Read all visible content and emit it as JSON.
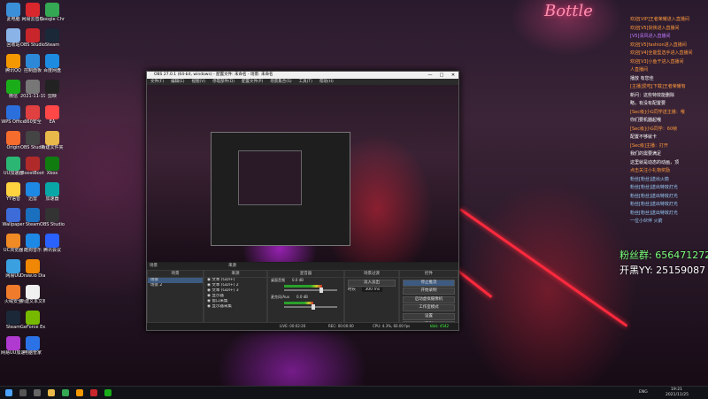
{
  "desktop_icons": [
    {
      "label": "此电脑",
      "color": "#3a8fd8",
      "col": 0,
      "row": 0
    },
    {
      "label": "网易云音乐",
      "color": "#d8282d",
      "col": 1,
      "row": 0
    },
    {
      "label": "Google Chrome",
      "color": "#34a853",
      "col": 2,
      "row": 0
    },
    {
      "label": "回收站",
      "color": "#8ab4e8",
      "col": 0,
      "row": 1
    },
    {
      "label": "OBS Studio",
      "color": "#c8262b",
      "col": 1,
      "row": 1
    },
    {
      "label": "Steam",
      "color": "#1b2838",
      "col": 2,
      "row": 1
    },
    {
      "label": "腾讯QQ",
      "color": "#f39800",
      "col": 0,
      "row": 2
    },
    {
      "label": "控制面板",
      "color": "#2d89d8",
      "col": 1,
      "row": 2
    },
    {
      "label": "百度网盘",
      "color": "#1c8be0",
      "col": 2,
      "row": 2
    },
    {
      "label": "微信",
      "color": "#1aad19",
      "col": 0,
      "row": 3
    },
    {
      "label": "2021-11-19",
      "color": "#777777",
      "col": 1,
      "row": 3
    },
    {
      "label": "剪映",
      "color": "#222222",
      "col": 2,
      "row": 3
    },
    {
      "label": "WPS Office",
      "color": "#2a6fdb",
      "col": 0,
      "row": 4
    },
    {
      "label": "360安全",
      "color": "#e04040",
      "col": 1,
      "row": 4
    },
    {
      "label": "EA",
      "color": "#ff4747",
      "col": 2,
      "row": 4
    },
    {
      "label": "Origin",
      "color": "#f56c2d",
      "col": 0,
      "row": 5
    },
    {
      "label": "OBS Studio",
      "color": "#444444",
      "col": 1,
      "row": 5
    },
    {
      "label": "新建文件夹",
      "color": "#e8b84a",
      "col": 2,
      "row": 5
    },
    {
      "label": "UU加速器",
      "color": "#2bb673",
      "col": 0,
      "row": 6
    },
    {
      "label": "BoostBoot",
      "color": "#b12a2a",
      "col": 1,
      "row": 6
    },
    {
      "label": "Xbox",
      "color": "#107c10",
      "col": 2,
      "row": 6
    },
    {
      "label": "YY语音",
      "color": "#ffd23f",
      "col": 0,
      "row": 7
    },
    {
      "label": "迅雷",
      "color": "#1e88e5",
      "col": 1,
      "row": 7
    },
    {
      "label": "加速器",
      "color": "#0aa7a7",
      "col": 2,
      "row": 7
    },
    {
      "label": "Wallpaper",
      "color": "#3d6bd8",
      "col": 0,
      "row": 8
    },
    {
      "label": "Steam",
      "color": "#1b6fbf",
      "col": 1,
      "row": 8
    },
    {
      "label": "OBS Studio",
      "color": "#333333",
      "col": 2,
      "row": 8
    },
    {
      "label": "UC浏览器",
      "color": "#f08a24",
      "col": 0,
      "row": 9
    },
    {
      "label": "酷狗音乐",
      "color": "#1e88e5",
      "col": 1,
      "row": 9
    },
    {
      "label": "腾讯会议",
      "color": "#2962ff",
      "col": 2,
      "row": 9
    },
    {
      "label": "网易UU",
      "color": "#3aa0e0",
      "col": 0,
      "row": 10
    },
    {
      "label": "Draw.io Diagrams",
      "color": "#f08705",
      "col": 1,
      "row": 10
    },
    {
      "label": "火绒安全",
      "color": "#f07b2b",
      "col": 0,
      "row": 11
    },
    {
      "label": "新建文本文档",
      "color": "#f0f0f0",
      "col": 1,
      "row": 11
    },
    {
      "label": "Steam",
      "color": "#1b2838",
      "col": 0,
      "row": 12
    },
    {
      "label": "GeForce Experience",
      "color": "#76b900",
      "col": 1,
      "row": 12
    },
    {
      "label": "网易UU加速器",
      "color": "#b03ad0",
      "col": 0,
      "row": 13
    },
    {
      "label": "电脑管家",
      "color": "#2b72e6",
      "col": 1,
      "row": 13
    }
  ],
  "chat": [
    {
      "text": "欢迎[VIP]王者荣耀进入直播间",
      "color": "#ff9a3d"
    },
    {
      "text": "欢迎[V5]剑侠进入直播间",
      "color": "#ff9a3d"
    },
    {
      "text": "[V5]清风进入直播间",
      "color": "#c07bff"
    },
    {
      "text": "欢迎[V5]fashion进入直播间",
      "color": "#ff9a3d"
    },
    {
      "text": "欢迎[V4]全能型选手进入直播间",
      "color": "#ff9a3d"
    },
    {
      "text": "欢迎[V3]小鱼干进入直播间",
      "color": "#ff9a3d"
    },
    {
      "text": "人直播间",
      "color": "#ff9a3d"
    },
    {
      "text": "播放 有您佳",
      "color": "#ffffff"
    },
    {
      "text": "[主播]爱吃[下载]王者荣耀有",
      "color": "#ff9a3d"
    },
    {
      "text": "新问：这些特效能删除",
      "color": "#ffffff"
    },
    {
      "text": "略，有没有配置要",
      "color": "#ffffff"
    },
    {
      "text": "[Sec级]小G同学送主播：哦",
      "color": "#ff9a3d"
    },
    {
      "text": "你们要机器起哦",
      "color": "#ffffff"
    },
    {
      "text": "[Sec级]小G同学：60帧",
      "color": "#ff9a3d"
    },
    {
      "text": "配置不够就卡",
      "color": "#ffffff"
    },
    {
      "text": "[Sec级]主播：打开",
      "color": "#ff9a3d"
    },
    {
      "text": "我们的需要满足",
      "color": "#ffffff"
    },
    {
      "text": "这里就是动态的动画，顶",
      "color": "#ffffff"
    },
    {
      "text": "",
      "color": "#ffffff"
    },
    {
      "text": "点击关注小礼物奖励",
      "color": "#ff9a3d"
    },
    {
      "text": "",
      "color": "#ffffff"
    },
    {
      "text": "粉丝[粉丝]送出火箭",
      "color": "#9ad0ff"
    },
    {
      "text": "粉丝[粉丝]送出特效灯光",
      "color": "#9ad0ff"
    },
    {
      "text": "粉丝[粉丝]送出特效灯光",
      "color": "#9ad0ff"
    },
    {
      "text": "粉丝[粉丝]送出特效灯光",
      "color": "#9ad0ff"
    },
    {
      "text": "粉丝[粉丝]送出特效灯光",
      "color": "#9ad0ff"
    },
    {
      "text": "一位小伙伴 火箭",
      "color": "#9ad0ff"
    }
  ],
  "fans_group": "粉丝群: 656471272",
  "yy_channel": "开黑YY: 25159087",
  "neon_sign": "Bottle",
  "side_chat": [
    "欢迎",
    "主播",
    "王者",
    "进入",
    "直播",
    "小鱼",
    "特效",
    "配置",
    "打开",
    "礼物",
    "粉丝群",
    "656471272",
    "开黑YY:",
    "25159087"
  ],
  "obs": {
    "title": "OBS 27.0.1 (64-bit, windows) - 配置文件: 未命名 - 场景: 未命名",
    "menu": [
      "文件(F)",
      "编辑(E)",
      "视图(V)",
      "停靠部件(D)",
      "配置文件(P)",
      "场景集合(S)",
      "工具(T)",
      "帮助(H)"
    ],
    "docks": {
      "scenes_label": "场景",
      "sources_label": "来源",
      "mixer_label": "混音器",
      "transitions_label": "场景过渡",
      "controls_label": "控件"
    },
    "scenes": [
      "场景",
      "场景 2"
    ],
    "sources": [
      "文本 (GDI+)",
      "文本 (GDI+) 2",
      "文本 (GDI+) 3",
      "显示器",
      "窗口采集",
      "显示器采集"
    ],
    "mixer": [
      {
        "name": "桌面音频",
        "db": "0.0 dB",
        "level": 0.72
      },
      {
        "name": "麦克风/Aux",
        "db": "0.0 dB",
        "level": 0.55
      }
    ],
    "transition": {
      "type": "淡入淡出",
      "duration_label": "时长",
      "duration": "300 ms"
    },
    "controls": [
      "停止推流",
      "开始录制",
      "启动虚拟摄像机",
      "工作室模式",
      "设置",
      "退出"
    ],
    "status": {
      "live": "LIVE: 00:02:26",
      "rec": "REC: 00:00:00",
      "cpu": "CPU: 4.3%, 60.00 fps",
      "kbps": "kb/s: 4542"
    }
  },
  "taskbar": {
    "time": "19:21",
    "date": "2021/11/25",
    "lang": "ENG"
  }
}
